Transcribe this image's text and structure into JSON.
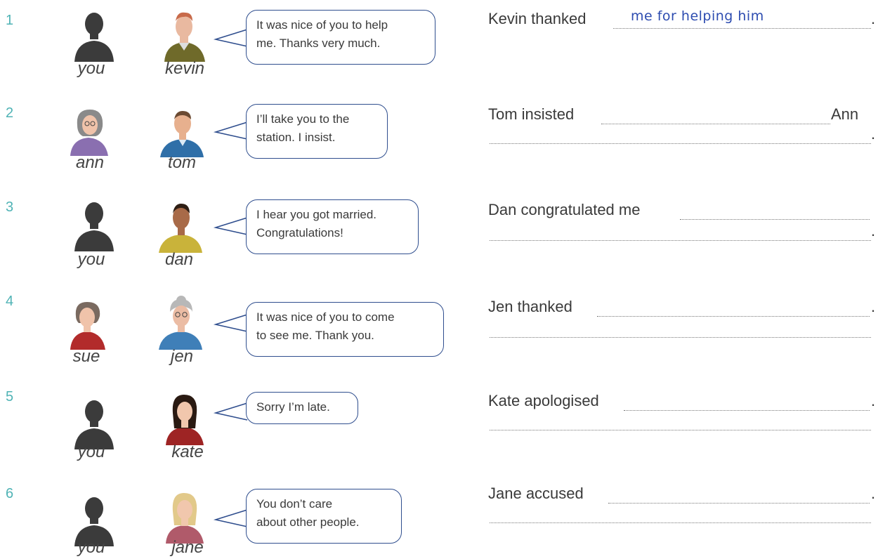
{
  "colors": {
    "number": "#4fb3b5",
    "bubble_border": "#2f4e8e",
    "handwriting": "#2d4cb0",
    "silhouette": "#3b3b3b"
  },
  "items": [
    {
      "number": "1",
      "left": {
        "label": "you",
        "icon": "person-silhouette-icon"
      },
      "right": {
        "label": "kevin",
        "icon": "old-man-portrait-icon"
      },
      "speech": [
        "It was nice of you to help",
        "me.  Thanks very much."
      ],
      "prompt": "Kevin thanked",
      "example_answer": "me for helping him",
      "line_end": "."
    },
    {
      "number": "2",
      "left": {
        "label": "ann",
        "icon": "woman-grey-hair-portrait-icon"
      },
      "right": {
        "label": "tom",
        "icon": "man-blue-shirt-portrait-icon"
      },
      "speech": [
        "I’ll take you to the",
        "station.  I insist."
      ],
      "prompt": "Tom insisted",
      "after_blank": "Ann",
      "line_end": "."
    },
    {
      "number": "3",
      "left": {
        "label": "you",
        "icon": "person-silhouette-icon"
      },
      "right": {
        "label": "dan",
        "icon": "man-yellow-shirt-portrait-icon"
      },
      "speech": [
        "I hear you got married.",
        "Congratulations!"
      ],
      "prompt": "Dan congratulated me",
      "line_end": "."
    },
    {
      "number": "4",
      "left": {
        "label": "sue",
        "icon": "woman-red-top-portrait-icon"
      },
      "right": {
        "label": "jen",
        "icon": "old-woman-portrait-icon"
      },
      "speech": [
        "It was nice of you to come",
        "to see me.  Thank you."
      ],
      "prompt": "Jen thanked",
      "line_end": "."
    },
    {
      "number": "5",
      "left": {
        "label": "you",
        "icon": "person-silhouette-icon"
      },
      "right": {
        "label": "kate",
        "icon": "woman-dark-hair-portrait-icon"
      },
      "speech": [
        "Sorry I’m late."
      ],
      "prompt": "Kate apologised",
      "line_end": "."
    },
    {
      "number": "6",
      "left": {
        "label": "you",
        "icon": "person-silhouette-icon"
      },
      "right": {
        "label": "jane",
        "icon": "woman-blonde-portrait-icon"
      },
      "speech": [
        "You don’t care",
        "about other people."
      ],
      "prompt": "Jane accused",
      "line_end": "."
    }
  ]
}
